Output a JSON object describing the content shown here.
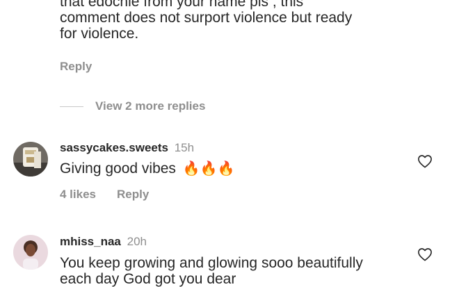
{
  "top_comment": {
    "lines": [
      "that edochie from your name pls , this",
      "comment does not surport violence but ready",
      "for violence."
    ],
    "reply_label": "Reply"
  },
  "view_replies_label": "View 2 more replies",
  "comments": [
    {
      "username": "sassycakes.sweets",
      "time": "15h",
      "text": "Giving good vibes",
      "emoji": "🔥🔥🔥",
      "likes_label": "4 likes",
      "reply_label": "Reply"
    },
    {
      "username": "mhiss_naa",
      "time": "20h",
      "text_line1": "You keep growing and glowing sooo beautifully",
      "text_line2": "each day God got you dear"
    }
  ],
  "icons": {
    "like": "heart-outline-icon",
    "emoji": "fire-emoji-icon"
  },
  "colors": {
    "text": "#262626",
    "secondary": "#8e8e8e",
    "divider": "#c7c7c7",
    "background": "#ffffff"
  }
}
